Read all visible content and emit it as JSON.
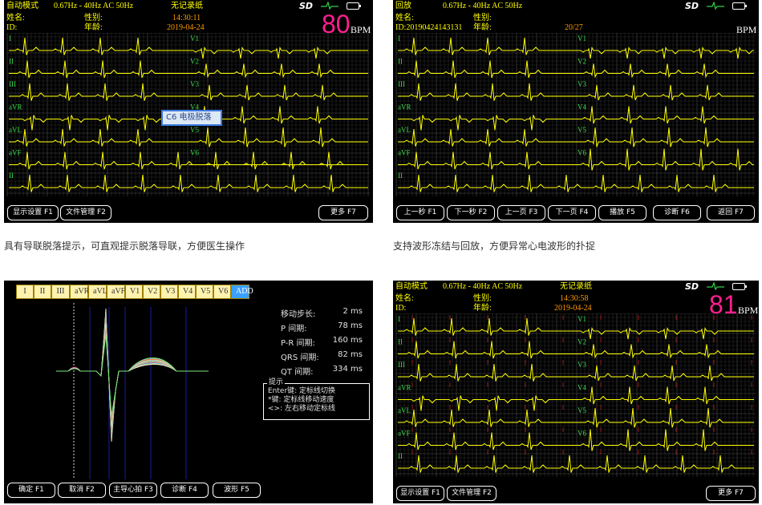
{
  "colors": {
    "waveform": "#ffff00",
    "bpm": "#ff1f8f",
    "grid": "#404040",
    "accent": "#3aa0ff"
  },
  "panel1": {
    "mode": "自动模式",
    "filter": "0.67Hz - 40Hz AC 50Hz",
    "paper": "无记录纸",
    "name_label": "姓名:",
    "id_label": "ID:",
    "sex_label": "性别:",
    "age_label": "年龄:",
    "time": "14:30:11",
    "date": "2019-04-24",
    "bpm": "80",
    "bpm_unit": "BPM",
    "popup": "C6 电极脱落",
    "leads_left": [
      "I",
      "II",
      "III",
      "aVR",
      "aVL",
      "aVF",
      "II"
    ],
    "leads_right": [
      "V1",
      "V2",
      "V3",
      "V4",
      "V5",
      "V6"
    ],
    "buttons": [
      "显示设置 F1",
      "文件管理 F2",
      "更多 F7"
    ],
    "caption": "具有导联脱落提示，可直观提示脱落导联，方便医生操作"
  },
  "panel2": {
    "mode": "回放",
    "filter": "0.67Hz - 40Hz AC 50Hz",
    "name_label": "姓名:",
    "id_label": "ID:20190424143131",
    "sex_label": "性别:",
    "age_label": "年龄:",
    "page": "20/27",
    "bpm_unit": "BPM",
    "leads_left": [
      "I",
      "II",
      "III",
      "aVR",
      "aVL",
      "aVF",
      "II"
    ],
    "leads_right": [
      "V1",
      "V2",
      "V3",
      "V4",
      "V5",
      "V6"
    ],
    "buttons": [
      "上一秒 F1",
      "下一秒 F2",
      "上一页 F3",
      "下一页 F4",
      "播放 F5",
      "诊断 F6",
      "返回 F7"
    ],
    "caption": "支持波形冻结与回放，方便异常心电波形的扑捉"
  },
  "panel3": {
    "lead_tabs": [
      "I",
      "II",
      "III",
      "aVR",
      "aVL",
      "aVF",
      "V1",
      "V2",
      "V3",
      "V4",
      "V5",
      "V6",
      "ADD"
    ],
    "measurements": [
      {
        "label": "移动步长:",
        "value": "2",
        "unit": "ms"
      },
      {
        "label": "P 间期:",
        "value": "78",
        "unit": "ms"
      },
      {
        "label": "P-R 间期:",
        "value": "160",
        "unit": "ms"
      },
      {
        "label": "QRS 间期:",
        "value": "82",
        "unit": "ms"
      },
      {
        "label": "QT 间期:",
        "value": "334",
        "unit": "ms"
      }
    ],
    "hint_title": "提示",
    "hint_lines": [
      "Enter键: 定标线切换",
      "*键: 定标线移动速度",
      "<>: 左右移动定标线"
    ],
    "buttons": [
      "确定 F1",
      "取消 F2",
      "主导心拍 F3",
      "诊断 F4",
      "波形 F5"
    ]
  },
  "panel4": {
    "mode": "自动模式",
    "filter": "0.67Hz - 40Hz AC 50Hz",
    "paper": "无记录纸",
    "name_label": "姓名:",
    "id_label": "ID:",
    "sex_label": "性别:",
    "age_label": "年龄:",
    "time": "14:30:58",
    "date": "2019-04-24",
    "bpm": "81",
    "bpm_unit": "BPM",
    "leads_left": [
      "I",
      "II",
      "III",
      "aVR",
      "aVL",
      "aVF",
      "II"
    ],
    "leads_right": [
      "V1",
      "V2",
      "V3",
      "V4",
      "V5",
      "V6"
    ],
    "buttons": [
      "显示设置 F1",
      "文件管理 F2",
      "更多 F7"
    ]
  }
}
